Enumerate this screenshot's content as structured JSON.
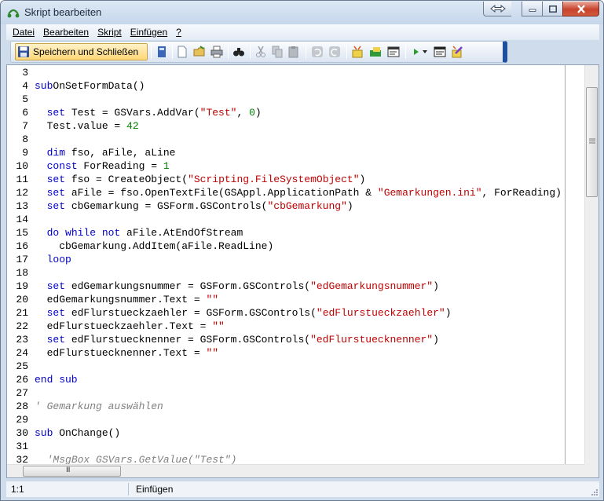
{
  "window": {
    "title": "Skript bearbeiten"
  },
  "menu": [
    "Datei",
    "Bearbeiten",
    "Skript",
    "Einfügen",
    "?"
  ],
  "toolbar": {
    "save_label": "Speichern und Schließen",
    "icons": [
      "book-icon",
      "new-document-icon",
      "open-folder-icon",
      "print-icon",
      "find-icon",
      "cut-icon",
      "copy-icon",
      "paste-icon",
      "undo-icon",
      "redo-icon",
      "insert-variable-icon",
      "insert-object-icon",
      "insert-form-icon",
      "run-icon",
      "run-dropdown-icon",
      "console-icon",
      "edit-script-icon"
    ]
  },
  "editor": {
    "lines": [
      {
        "n": "3",
        "tokens": []
      },
      {
        "n": "4",
        "tokens": [
          [
            "kw",
            "sub"
          ],
          [
            "",
            "OnSetFormData()"
          ]
        ]
      },
      {
        "n": "5",
        "tokens": []
      },
      {
        "n": "6",
        "tokens": [
          [
            "",
            "  "
          ],
          [
            "kw",
            "set"
          ],
          [
            "",
            ""
          ],
          [
            "",
            "Test = GSVars.AddVar("
          ],
          [
            "str",
            "\"Test\""
          ],
          [
            "",
            ", "
          ],
          [
            "num",
            "0"
          ],
          [
            "",
            ")"
          ]
        ]
      },
      {
        "n": "7",
        "tokens": [
          [
            "",
            "  Test.value = "
          ],
          [
            "num",
            "42"
          ]
        ]
      },
      {
        "n": "8",
        "tokens": []
      },
      {
        "n": "9",
        "tokens": [
          [
            "",
            "  "
          ],
          [
            "kw",
            "dim"
          ],
          [
            "",
            " fso, aFile, aLine"
          ]
        ]
      },
      {
        "n": "10",
        "tokens": [
          [
            "",
            "  "
          ],
          [
            "kw",
            "const"
          ],
          [
            "",
            ""
          ],
          [
            "",
            "ForReading = "
          ],
          [
            "num",
            "1"
          ]
        ]
      },
      {
        "n": "11",
        "tokens": [
          [
            "",
            "  "
          ],
          [
            "kw",
            "set"
          ],
          [
            "",
            ""
          ],
          [
            "",
            "fso = CreateObject("
          ],
          [
            "str",
            "\"Scripting.FileSystemObject\""
          ],
          [
            "",
            ")"
          ]
        ]
      },
      {
        "n": "12",
        "tokens": [
          [
            "",
            "  "
          ],
          [
            "kw",
            "set"
          ],
          [
            "",
            ""
          ],
          [
            "",
            "aFile = fso.OpenTextFile(GSAppl.ApplicationPath & "
          ],
          [
            "str",
            "\"Gemarkungen.ini\""
          ],
          [
            "",
            ", ForReading)"
          ]
        ]
      },
      {
        "n": "13",
        "tokens": [
          [
            "",
            "  "
          ],
          [
            "kw",
            "set"
          ],
          [
            "",
            ""
          ],
          [
            "",
            "cbGemarkung = GSForm.GSControls("
          ],
          [
            "str",
            "\"cbGemarkung\""
          ],
          [
            "",
            ")"
          ]
        ]
      },
      {
        "n": "14",
        "tokens": []
      },
      {
        "n": "15",
        "tokens": [
          [
            "",
            "  "
          ],
          [
            "kw",
            "do while not"
          ],
          [
            "",
            ""
          ],
          [
            "",
            "aFile.AtEndOfStream"
          ]
        ]
      },
      {
        "n": "16",
        "tokens": [
          [
            "",
            "    cbGemarkung.AddItem(aFile.ReadLine)"
          ]
        ]
      },
      {
        "n": "17",
        "tokens": [
          [
            "",
            "  "
          ],
          [
            "kw",
            "loop"
          ]
        ]
      },
      {
        "n": "18",
        "tokens": []
      },
      {
        "n": "19",
        "tokens": [
          [
            "",
            "  "
          ],
          [
            "kw",
            "set"
          ],
          [
            "",
            ""
          ],
          [
            "",
            "edGemarkungsnummer = GSForm.GSControls("
          ],
          [
            "str",
            "\"edGemarkungsnummer\""
          ],
          [
            "",
            ")"
          ]
        ]
      },
      {
        "n": "20",
        "tokens": [
          [
            "",
            "  edGemarkungsnummer.Text = "
          ],
          [
            "str",
            "\"\""
          ]
        ]
      },
      {
        "n": "21",
        "tokens": [
          [
            "",
            "  "
          ],
          [
            "kw",
            "set"
          ],
          [
            "",
            ""
          ],
          [
            "",
            "edFlurstueckzaehler = GSForm.GSControls("
          ],
          [
            "str",
            "\"edFlurstueckzaehler\""
          ],
          [
            "",
            ")"
          ]
        ]
      },
      {
        "n": "22",
        "tokens": [
          [
            "",
            "  edFlurstueckzaehler.Text = "
          ],
          [
            "str",
            "\"\""
          ]
        ]
      },
      {
        "n": "23",
        "tokens": [
          [
            "",
            "  "
          ],
          [
            "kw",
            "set"
          ],
          [
            "",
            ""
          ],
          [
            "",
            "edFlurstuecknenner = GSForm.GSControls("
          ],
          [
            "str",
            "\"edFlurstuecknenner\""
          ],
          [
            "",
            ")"
          ]
        ]
      },
      {
        "n": "24",
        "tokens": [
          [
            "",
            "  edFlurstuecknenner.Text = "
          ],
          [
            "str",
            "\"\""
          ]
        ]
      },
      {
        "n": "25",
        "tokens": []
      },
      {
        "n": "26",
        "tokens": [
          [
            "kw",
            "end sub"
          ]
        ]
      },
      {
        "n": "27",
        "tokens": []
      },
      {
        "n": "28",
        "tokens": [
          [
            "cmt",
            "' Gemarkung auswählen"
          ]
        ]
      },
      {
        "n": "29",
        "tokens": []
      },
      {
        "n": "30",
        "tokens": [
          [
            "kw",
            "sub"
          ],
          [
            "",
            ""
          ],
          [
            "",
            "OnChange()"
          ]
        ]
      },
      {
        "n": "31",
        "tokens": []
      },
      {
        "n": "32",
        "tokens": [
          [
            "",
            "  "
          ],
          [
            "cmt",
            "'MsgBox GSVars.GetValue(\"Test\")"
          ]
        ]
      }
    ]
  },
  "hscroll_label": "III",
  "status": {
    "position": "1:1",
    "mode": "Einfügen"
  }
}
